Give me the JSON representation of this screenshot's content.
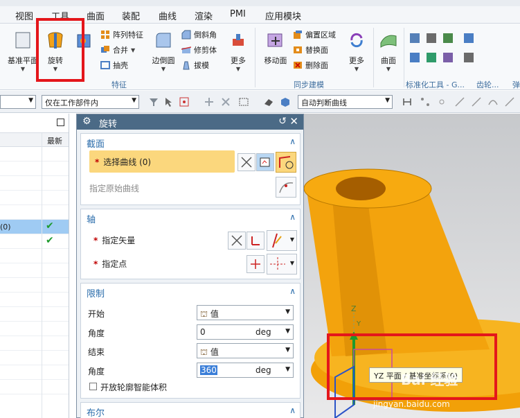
{
  "menu": [
    "视图",
    "工具",
    "曲面",
    "装配",
    "曲线",
    "渲染",
    "PMI",
    "应用模块"
  ],
  "ribbon": {
    "datum_plane": "基准平面",
    "revolve": "旋转",
    "feature_pattern": "阵列特征",
    "unite": "合并",
    "shell": "抽壳",
    "edge_blend": "边倒圆",
    "chamfer": "倒斜角",
    "trim_body": "修剪体",
    "draft": "拔模",
    "more1": "更多",
    "move_face": "移动面",
    "offset_region": "偏置区域",
    "replace_face": "替换面",
    "delete_face": "删除面",
    "more2": "更多",
    "surface": "曲面",
    "group_feature": "特征",
    "group_sync": "同步建模",
    "group_std": "标准化工具 - G...",
    "group_gear": "齿轮...",
    "group_spring": "弹"
  },
  "toolbar": {
    "scope_select": "仅在工作部件内",
    "curve_rule": "自动判断曲线"
  },
  "nav": {
    "col_latest": "最新",
    "row_fragment": "(0)"
  },
  "dialog": {
    "title": "旋转",
    "section_profile": "截面",
    "select_curve": "选择曲线 (0)",
    "specify_origin_curve": "指定原始曲线",
    "section_axis": "轴",
    "specify_vector": "指定矢量",
    "specify_point": "指定点",
    "section_limits": "限制",
    "start": "开始",
    "angle1_label": "角度",
    "start_value_type": "值",
    "angle1_value": "0",
    "unit1": "deg",
    "end": "结束",
    "end_value_type": "值",
    "angle2_label": "角度",
    "angle2_value": "360",
    "unit2": "deg",
    "open_profile": "开放轮廓智能体积",
    "section_boolean": "布尔"
  },
  "viewport": {
    "axis_z": "Z",
    "axis_y": "Y",
    "tooltip": "YZ 平面 / 基准坐标系(0)"
  },
  "watermark": {
    "brand": "Bai 经验",
    "url": "jingyan.baidu.com"
  }
}
